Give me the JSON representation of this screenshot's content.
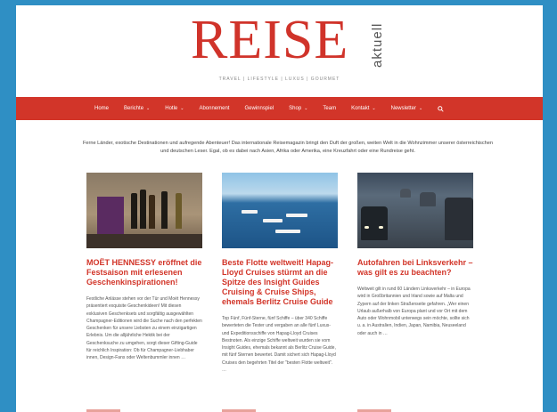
{
  "site": {
    "logo_main": "REISE",
    "logo_sub": "aktuell",
    "tagline": "TRAVEL | LIFESTYLE | LUXUS | GOURMET"
  },
  "nav": {
    "items": [
      {
        "label": "Home"
      },
      {
        "label": "Berichte",
        "caret": "⌄"
      },
      {
        "label": "Hotle",
        "caret": "⌄"
      },
      {
        "label": "Abonnement"
      },
      {
        "label": "Gewinnspiel"
      },
      {
        "label": "Shop",
        "caret": "⌄"
      },
      {
        "label": "Team"
      },
      {
        "label": "Kontakt",
        "caret": "⌄"
      },
      {
        "label": "Newsletter",
        "caret": "⌄"
      }
    ],
    "search_icon": "search-icon"
  },
  "intro": "Ferne Länder, exotische Destinationen und aufregende Abenteuer! Das internationale Reisemagazin bringt den Duft der großen, weiten Welt in die Wohnzimmer unserer österreichischen und deutschen Leser. Egal, ob es dabei nach Asien, Afrika oder Amerika, eine Kreuzfahrt oder eine Rundreise geht.",
  "cards": [
    {
      "title": "MOËT HENNESSY eröffnet die Festsaison mit erlesenen Geschenkinspirationen!",
      "body": "Festliche Anlässe stehen vor der Tür und Moët Hennessy präsentiert exquisite Geschenkideen! Mit diesen exklusiven Geschenksets und sorgfältig ausgewählten Champagner-Editionen wird die Suche nach den perfekten Geschenken für unsere Liebsten zu einem einzigartigen Erlebnis. Um die alljährliche Hektik bei der Geschenksuche zu umgehen, sorgt dieser Gifting-Guide für reichlich Inspiration: Ob für Champagner-Liebhaber innen, Design-Fans oder Weltenbummler innen …"
    },
    {
      "title": "Beste Flotte weltweit! Hapag-Lloyd Cruises stürmt an die Spitze des Insight Guides Cruising & Cruise Ships, ehemals Berlitz Cruise Guide",
      "body": "Top Fünf, Fünf-Sterne, fünf Schiffe – über 340 Schiffe bewerteten die Tester und vergaben an alle fünf Luxus- und Expeditionsschiffe von Hapag-Lloyd Cruises Bestnoten. Als einzige Schiffe weltweit wurden sie vom Insight Guides, ehemals bekannt als Berlitz Cruise Guide, mit fünf Sternen bewertet. Damit sichert sich Hapag-Lloyd Cruises den begehrten Titel der \"besten Flotte weltweit\". …"
    },
    {
      "title": "Autofahren bei Linksverkehr – was gilt es zu beachten?",
      "body": "Weltweit gilt in rund 60 Ländern Linksverkehr – in Europa wird in Großbritannien und Irland sowie auf Malta und Zypern auf der linken Straßenseite gefahren. „Wer einen Urlaub außerhalb von Europa plant und vor Ort mit dem Auto oder Wohnmobil unterwegs sein möchte, sollte sich u. a. in Australien, Indien, Japan, Namibia, Neuseeland oder auch in …"
    }
  ],
  "colors": {
    "accent": "#d23529",
    "background": "#2f8fc4"
  }
}
